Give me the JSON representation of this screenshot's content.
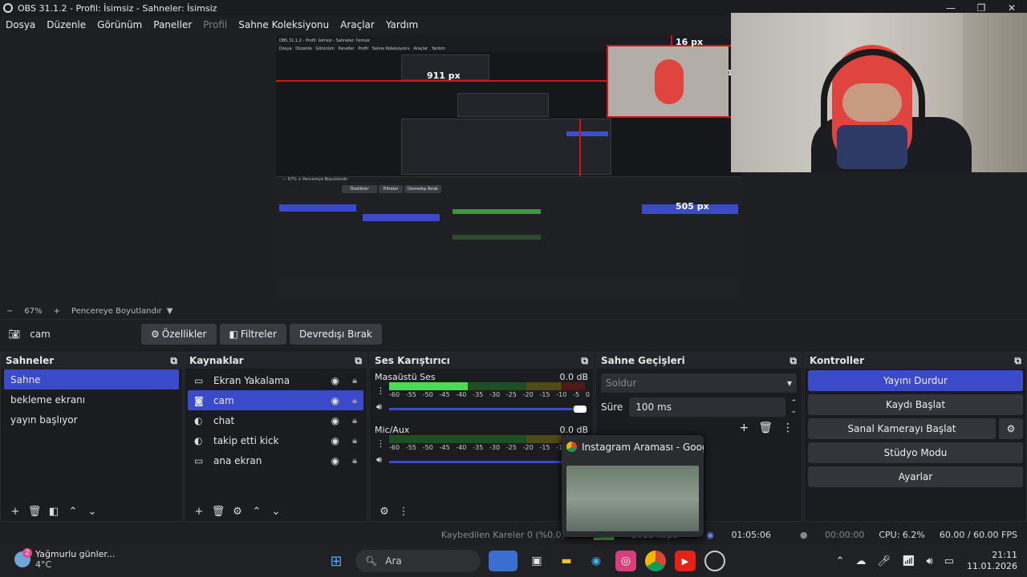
{
  "window": {
    "title": "OBS 31.1.2 - Profil: İsimsiz - Sahneler: İsimsiz",
    "controls": [
      "—",
      "❐",
      "✕"
    ]
  },
  "menu": [
    {
      "label": "Dosya",
      "disabled": false
    },
    {
      "label": "Düzenle",
      "disabled": false
    },
    {
      "label": "Görünüm",
      "disabled": false
    },
    {
      "label": "Paneller",
      "disabled": false
    },
    {
      "label": "Profil",
      "disabled": true
    },
    {
      "label": "Sahne Koleksiyonu",
      "disabled": false
    },
    {
      "label": "Araçlar",
      "disabled": false
    },
    {
      "label": "Yardım",
      "disabled": false
    }
  ],
  "preview": {
    "labels": {
      "top": "16 px",
      "left": "911 px",
      "small": "505 px",
      "side": "1"
    },
    "inner_title": "OBS 31.1.2 - Profil: İsimsiz - Sahneler: İsimsiz",
    "inner_menu": "Dosya   Düzenle   Görünüm   Paneller   Profil   Sahne Koleksiyonu   Araçlar   Yardım",
    "inner_srcbar": [
      "cam",
      "Özellikler",
      "Filtreler",
      "Devredışı Bırak"
    ],
    "inner_zoom": "— 67% + Pencereye Boyutlandır"
  },
  "zoombar": {
    "minus": "−",
    "zoom": "67%",
    "plus": "+",
    "fit": "Pencereye Boyutlandır",
    "caret": "▼"
  },
  "source_toolbar": {
    "current": "cam",
    "properties": "Özellikler",
    "filters": "Filtreler",
    "disable": "Devredışı Bırak"
  },
  "scenes": {
    "title": "Sahneler",
    "items": [
      "Sahne",
      "bekleme ekranı",
      "yayın başlıyor"
    ],
    "selected": 0
  },
  "sources": {
    "title": "Kaynaklar",
    "items": [
      {
        "label": "Ekran Yakalama",
        "icon": "monitor-icon"
      },
      {
        "label": "cam",
        "icon": "camera-icon"
      },
      {
        "label": "chat",
        "icon": "browser-icon"
      },
      {
        "label": "takip etti kick",
        "icon": "browser-icon"
      },
      {
        "label": "ana ekran",
        "icon": "monitor-icon"
      }
    ],
    "selected": 1
  },
  "mixer": {
    "title": "Ses Karıştırıcı",
    "channels": [
      {
        "name": "Masaüstü Ses",
        "db": "0.0 dB",
        "level": 0.4
      },
      {
        "name": "Mic/Aux",
        "db": "0.0 dB",
        "level": 0.0
      }
    ],
    "ticks": [
      "-60",
      "-55",
      "-50",
      "-45",
      "-40",
      "-35",
      "-30",
      "-25",
      "-20",
      "-15",
      "-10",
      "-5",
      "0"
    ]
  },
  "transitions": {
    "title": "Sahne Geçişleri",
    "selected": "Soldur",
    "duration_label": "Süre",
    "duration_value": "100 ms"
  },
  "controls": {
    "title": "Kontroller",
    "stop_stream": "Yayını Durdur",
    "start_record": "Kaydı Başlat",
    "virtual_cam": "Sanal Kamerayı Başlat",
    "studio_mode": "Stüdyo Modu",
    "settings": "Ayarlar"
  },
  "status": {
    "dropped": "Kaybedilen Kareler 0 (%0.0)",
    "bitrate": "2611 kbps",
    "stream_time": "01:05:06",
    "record_time": "00:00:00",
    "cpu": "CPU: 6.2%",
    "fps": "60.00 / 60.00 FPS"
  },
  "popup": {
    "title": "Instagram Araması - Goog..."
  },
  "taskbar": {
    "weather_title": "Yağmurlu günler...",
    "weather_temp": "4°C",
    "weather_badge": "2",
    "search": "Ara",
    "time": "21:11",
    "date": "11.01.2026"
  },
  "colors": {
    "accent": "#3a4ac9",
    "record_red": "#d41414",
    "meter_green": "#4ed94e"
  }
}
